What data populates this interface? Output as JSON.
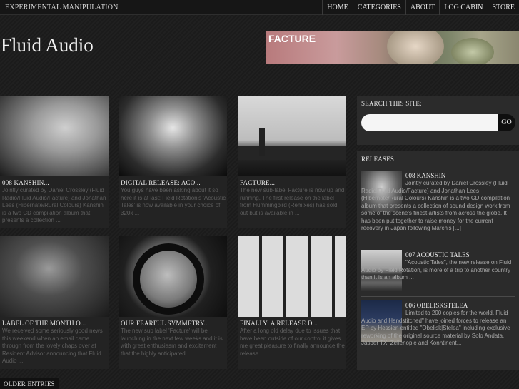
{
  "site": {
    "tagline": "EXPERIMENTAL MANIPULATION",
    "title": "Fluid Audio"
  },
  "nav": [
    "HOME",
    "CATEGORIES",
    "ABOUT",
    "LOG CABIN",
    "STORE"
  ],
  "banner": {
    "label": "FACTURE"
  },
  "posts": [
    {
      "title": "008 KANSHIN...",
      "excerpt": "Jointly curated by Daniel Crossley (Fluid Radio/Fluid Audio/Facture) and Jonathan Lees (Hibernate/Rural Colours) Kanshin is a two CD compilation album that presents a collection ..."
    },
    {
      "title": "DIGITAL RELEASE: ACO...",
      "excerpt": "You guys have been asking about it so here it is at last: Field Rotation's 'Acoustic Tales' is now available in your choice of 320k ..."
    },
    {
      "title": "FACTURE...",
      "excerpt": "The new sub-label Facture is now up and running. The first release on the label from Hummingbird (Remixes) has sold out but is available in ..."
    },
    {
      "title": "LABEL OF THE MONTH O...",
      "excerpt": "We received some seriously good news this weekend when an email came through from the lovely chaps over at Resident Advisor announcing that Fluid Audio ..."
    },
    {
      "title": "OUR FEARFUL SYMMETRY...",
      "excerpt": "The new sub label 'Facture' will be launching in the next few weeks and it is with great enthusiasm and excitement that the highly anticipated ..."
    },
    {
      "title": "FINALLY: A RELEASE D...",
      "excerpt": "After a long old delay due to issues that have been outside of our control it gives me great pleasure to finally announce the release ..."
    }
  ],
  "sidebar": {
    "search": {
      "title": "SEARCH THIS SITE:",
      "placeholder": "",
      "button": "GO"
    },
    "releases": {
      "title": "RELEASES",
      "items": [
        {
          "title": "008 KANSHIN",
          "text": "Jointly curated by Daniel Crossley (Fluid Radio/Fluid Audio/Facture) and Jonathan Lees (Hibernate/Rural Colours) Kanshin is a two CD compilation album that presents a collection of sound design work from some of the scene's finest artists from across the globe. It has been put together to raise money for the current recovery in Japan following March's [...]"
        },
        {
          "title": "007 ACOUSTIC TALES",
          "text": "\"Acoustic Tales\", the new release on Fluid Audio by Field Rotation, is more of a trip to another country than it is an album ..."
        },
        {
          "title": "006 OBELISKSTELEA",
          "text": "Limited to 200 copies for the world. Fluid Audio and Handstitched\" have joined forces to release an EP by Hessien entitled \"Obelisk|Stelea\" including exclusive reworking of the original source material by Solo Andata, Jasper TX, Zelienople and Konntinent..."
        }
      ]
    }
  },
  "pagination": {
    "older": "OLDER ENTRIES"
  }
}
